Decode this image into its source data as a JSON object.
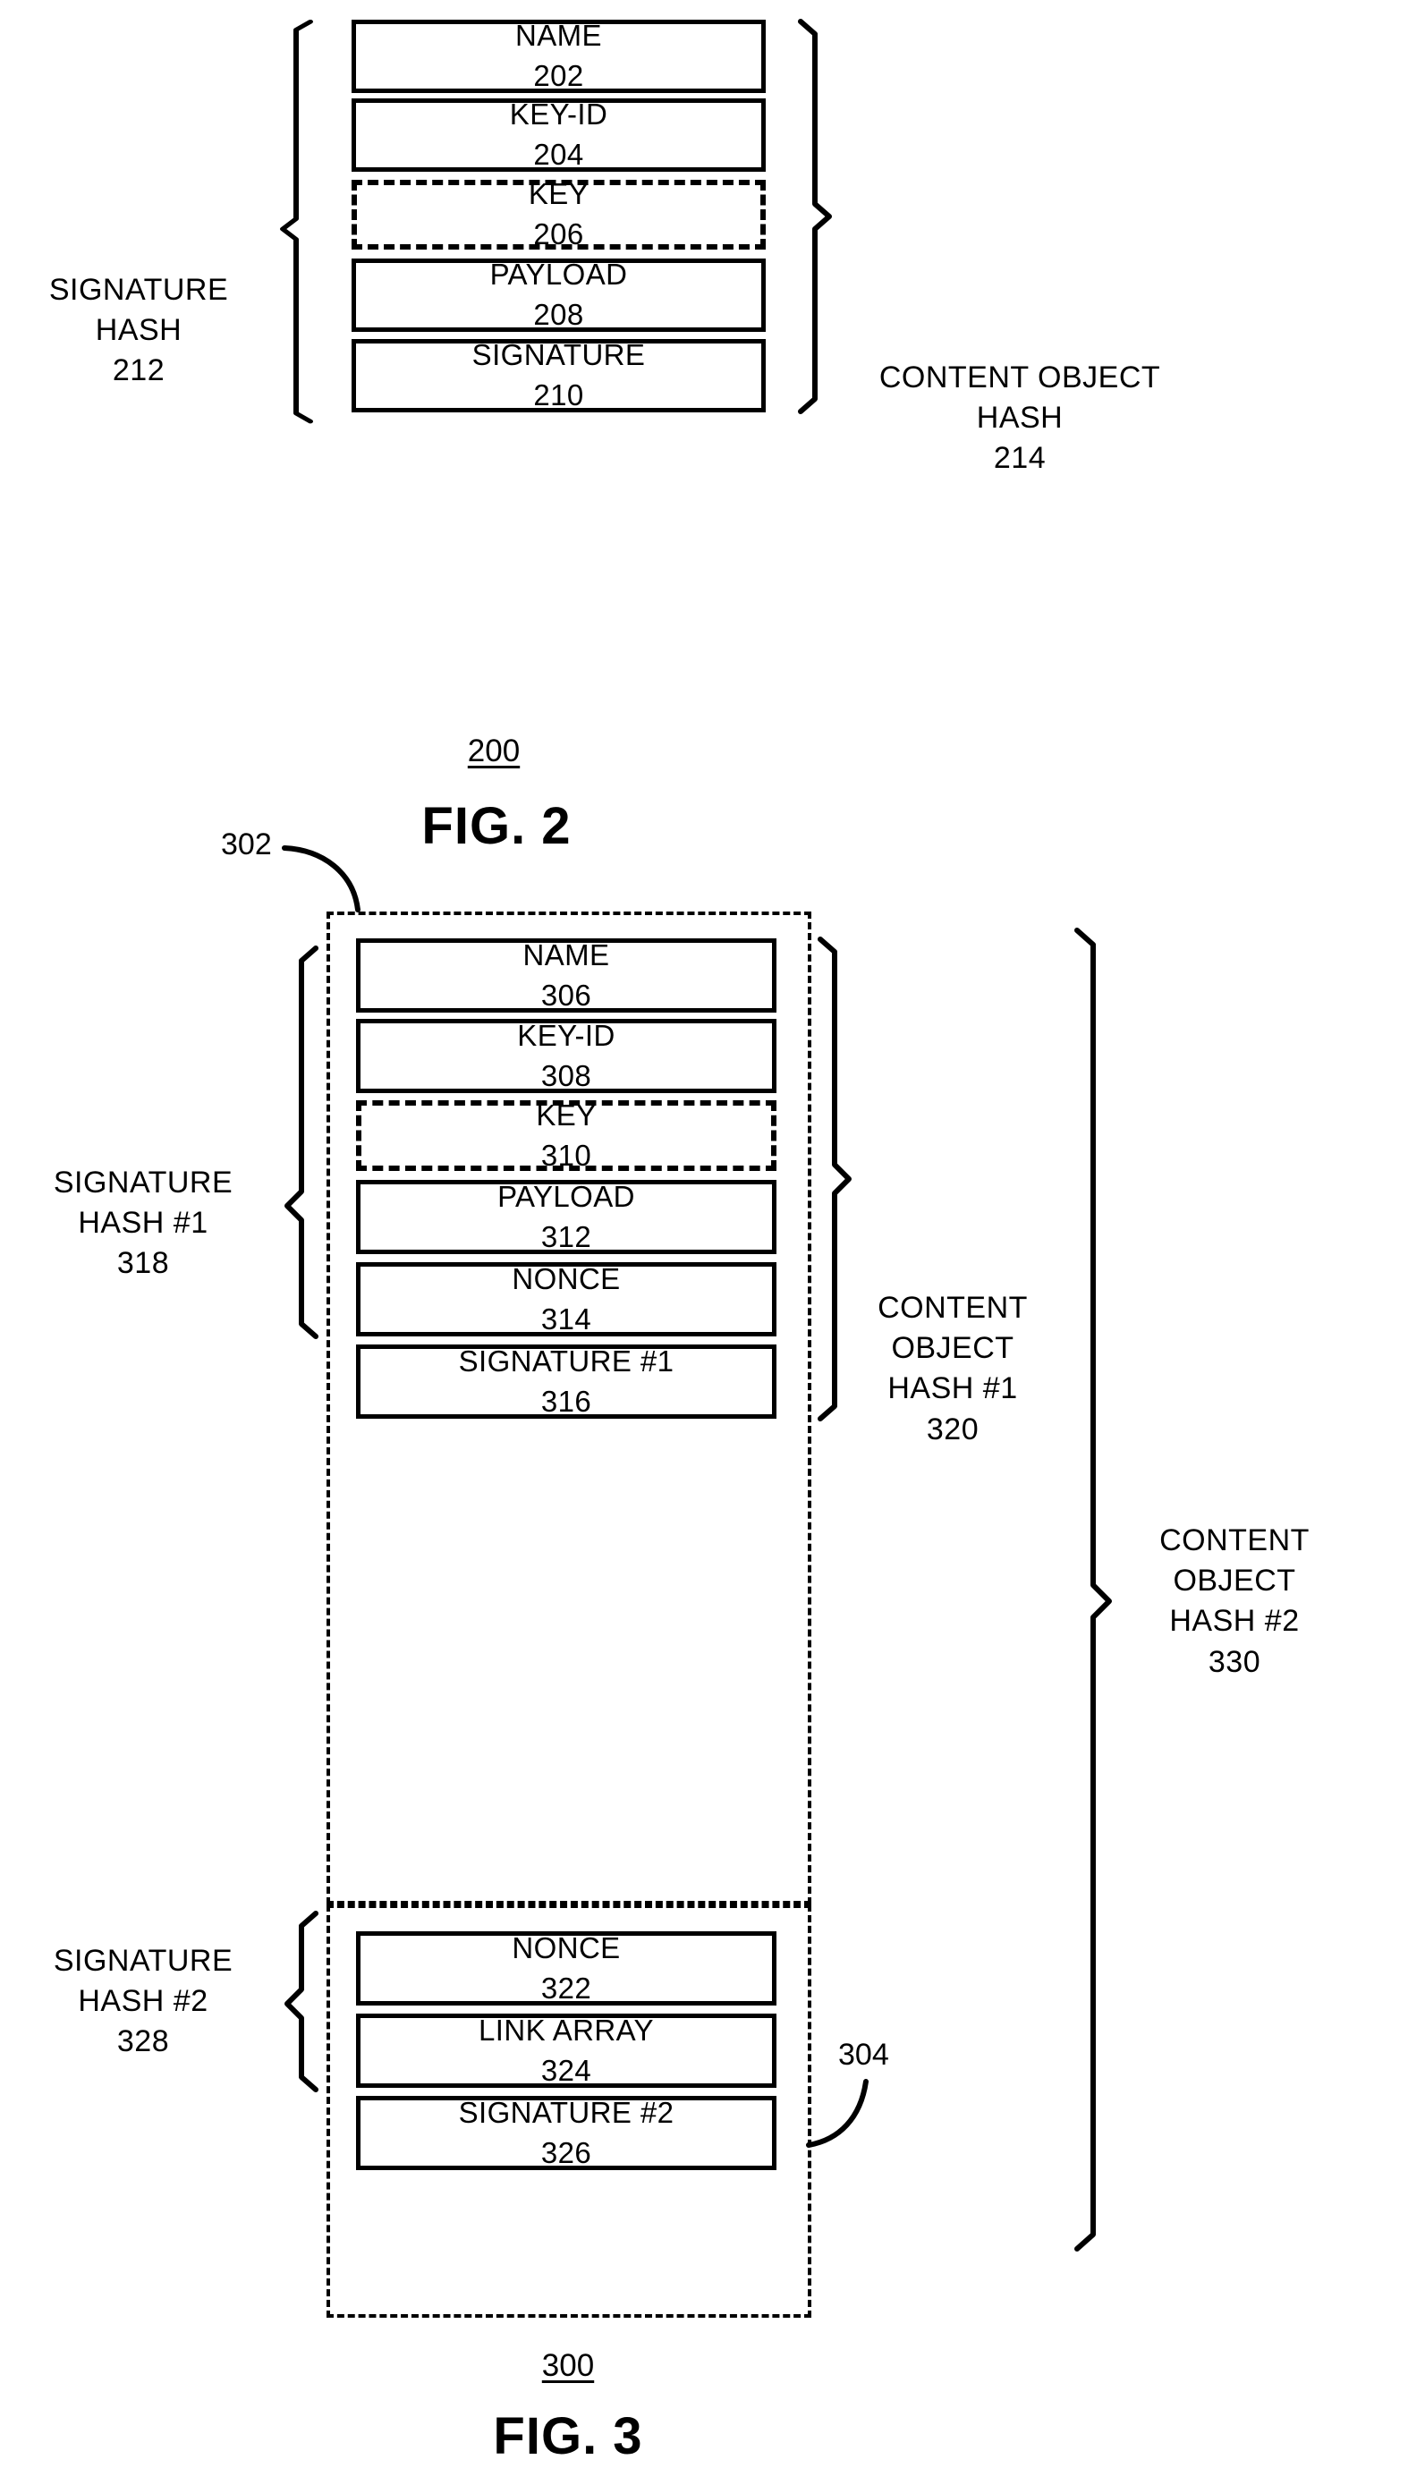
{
  "figures": [
    {
      "id": "fig-2",
      "caption": "FIG. 2",
      "figure_number": "200",
      "boxes": [
        {
          "title": "NAME",
          "number": "202",
          "style": "solid"
        },
        {
          "title": "KEY-ID",
          "number": "204",
          "style": "solid"
        },
        {
          "title": "KEY",
          "number": "206",
          "style": "dashed"
        },
        {
          "title": "PAYLOAD",
          "number": "208",
          "style": "solid"
        },
        {
          "title": "SIGNATURE",
          "number": "210",
          "style": "solid"
        }
      ],
      "braces": [
        {
          "side": "left",
          "label": "SIGNATURE\nHASH\n212",
          "spans": "202-208"
        },
        {
          "side": "right",
          "label": "CONTENT OBJECT\nHASH\n214",
          "spans": "202-210"
        }
      ]
    },
    {
      "id": "fig-3",
      "caption": "FIG. 3",
      "figure_number": "300",
      "groups": [
        {
          "callout": "302",
          "boxes": [
            "306",
            "308",
            "310",
            "312",
            "314",
            "316"
          ]
        },
        {
          "callout": "304",
          "boxes": [
            "322",
            "324",
            "326"
          ]
        }
      ],
      "boxes": [
        {
          "title": "NAME",
          "number": "306",
          "style": "solid"
        },
        {
          "title": "KEY-ID",
          "number": "308",
          "style": "solid"
        },
        {
          "title": "KEY",
          "number": "310",
          "style": "dashed"
        },
        {
          "title": "PAYLOAD",
          "number": "312",
          "style": "solid"
        },
        {
          "title": "NONCE",
          "number": "314",
          "style": "solid"
        },
        {
          "title": "SIGNATURE #1",
          "number": "316",
          "style": "solid"
        },
        {
          "title": "NONCE",
          "number": "322",
          "style": "solid"
        },
        {
          "title": "LINK ARRAY",
          "number": "324",
          "style": "solid"
        },
        {
          "title": "SIGNATURE #2",
          "number": "326",
          "style": "solid"
        }
      ],
      "braces": [
        {
          "side": "left",
          "label": "SIGNATURE\nHASH #1\n318",
          "spans": "306-314"
        },
        {
          "side": "right",
          "label": "CONTENT\nOBJECT\nHASH #1\n320",
          "spans": "306-316"
        },
        {
          "side": "left",
          "label": "SIGNATURE\nHASH #2\n328",
          "spans": "322-324"
        },
        {
          "side": "right",
          "label": "CONTENT\nOBJECT\nHASH #2\n330",
          "spans": "306-326"
        }
      ]
    }
  ],
  "colors": {
    "ink": "#000000",
    "paper": "#ffffff"
  }
}
